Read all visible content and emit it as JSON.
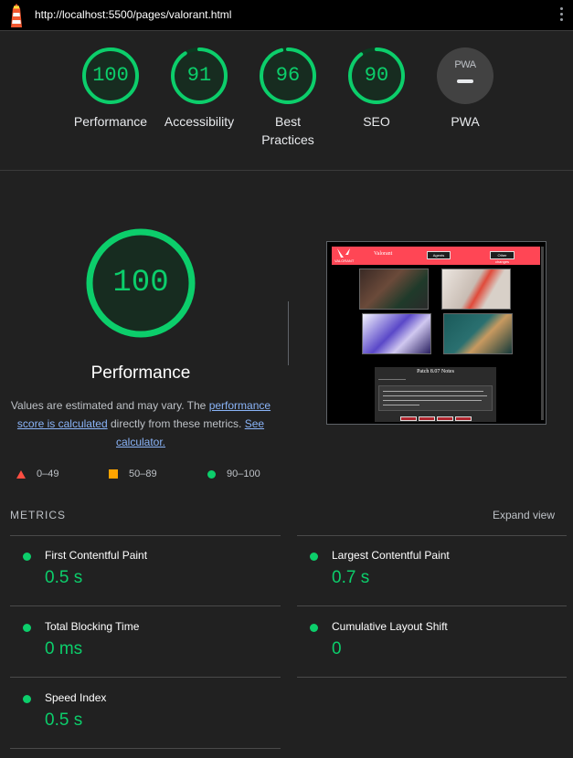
{
  "topbar": {
    "url": "http://localhost:5500/pages/valorant.html",
    "logo_icon": "lighthouse-icon",
    "menu_icon": "more-vertical-icon"
  },
  "gauges": [
    {
      "score": "100",
      "label": "Performance",
      "fraction": 1.0
    },
    {
      "score": "91",
      "label": "Accessibility",
      "fraction": 0.91
    },
    {
      "score": "96",
      "label": "Best Practices",
      "fraction": 0.96
    },
    {
      "score": "90",
      "label": "SEO",
      "fraction": 0.9
    },
    {
      "score": "PWA",
      "label": "PWA",
      "fraction": 0
    }
  ],
  "colors": {
    "pass": "#0cce6b",
    "average": "#ffa400",
    "fail": "#ff4e42",
    "link": "#8ab4f8",
    "brand_red": "#ff4655"
  },
  "performance": {
    "score": "100",
    "fraction": 1.0,
    "title": "Performance",
    "desc_1": "Values are estimated and may vary. The",
    "desc_link": "performance score is calculated",
    "desc_2": "directly from these metrics.",
    "calc_link": "See calculator."
  },
  "legend": [
    {
      "range": "0–49"
    },
    {
      "range": "50–89"
    },
    {
      "range": "90–100"
    }
  ],
  "screenshot": {
    "site_title": "Valorant",
    "logo_text": "VALORANT",
    "btn_agents": "Agents",
    "btn_other": "Other changes",
    "notes_title": "Patch 8.07 Notes"
  },
  "metrics": {
    "heading": "METRICS",
    "expand": "Expand view",
    "fcp": {
      "name": "First Contentful Paint",
      "value": "0.5 s"
    },
    "lcp": {
      "name": "Largest Contentful Paint",
      "value": "0.7 s"
    },
    "tbt": {
      "name": "Total Blocking Time",
      "value": "0 ms"
    },
    "cls": {
      "name": "Cumulative Layout Shift",
      "value": "0"
    },
    "si": {
      "name": "Speed Index",
      "value": "0.5 s"
    }
  }
}
